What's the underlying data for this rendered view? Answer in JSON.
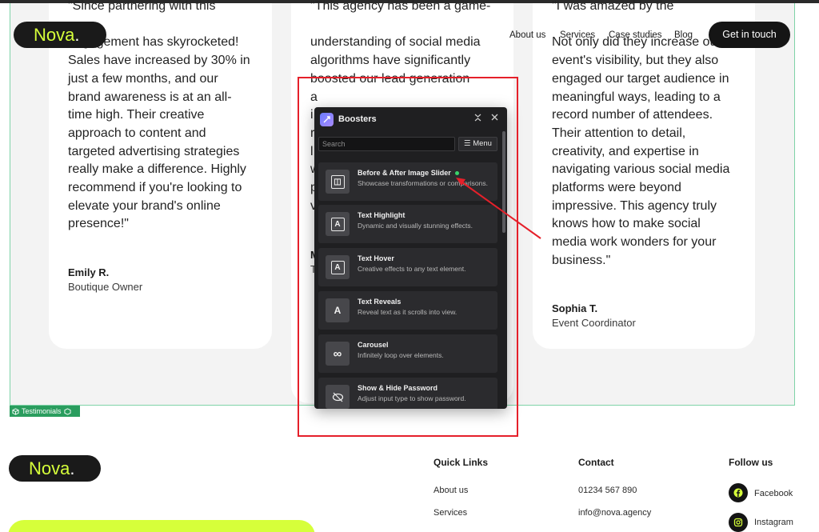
{
  "nav": {
    "logo_text": "Nova",
    "logo_dot": ".",
    "links": [
      "About us",
      "Services",
      "Case studies",
      "Blog"
    ],
    "cta": "Get in touch"
  },
  "testimonials": [
    {
      "lines": [
        "\"Since partnering with this",
        "",
        "engagement has skyrocketed!",
        "Sales have increased by 30% in",
        "just a few months, and our",
        "brand awareness is at an all-",
        "time high. Their creative",
        "approach to content and",
        "targeted advertising strategies",
        "really make a difference. Highly",
        "recommend if you're looking to",
        "elevate your brand's online",
        "presence!\""
      ],
      "author": "Emily R.",
      "role": "Boutique Owner"
    },
    {
      "lines": [
        "\"This agency has been a game-",
        "",
        "understanding of social media",
        "algorithms have significantly",
        "boosted our lead generation",
        "a",
        "i",
        "r",
        "l",
        "w",
        "p",
        "v"
      ],
      "author": "M",
      "role": "T"
    },
    {
      "lines": [
        "\"I was amazed by the",
        "",
        "Not only did they increase our",
        "event's visibility, but they also",
        "engaged our target audience in",
        "meaningful ways, leading to a",
        "record number of attendees.",
        "Their attention to detail,",
        "creativity, and expertise in",
        "navigating various social media",
        "platforms were beyond",
        "impressive. This agency truly",
        "knows how to make social",
        "media work wonders for your",
        "business.\""
      ],
      "author": "Sophia T.",
      "role": "Event Coordinator"
    }
  ],
  "section_tag": "Testimonials",
  "boosters": {
    "title": "Boosters",
    "search_placeholder": "Search",
    "menu_label": "Menu",
    "items": [
      {
        "title": "Before & After Image Slider",
        "desc": "Showcase transformations or comparisons.",
        "icon": "image-slider-icon"
      },
      {
        "title": "Text Highlight",
        "desc": "Dynamic and visually stunning effects.",
        "icon": "text-icon"
      },
      {
        "title": "Text Hover",
        "desc": "Creative effects to any text element.",
        "icon": "text-icon"
      },
      {
        "title": "Text Reveals",
        "desc": "Reveal text as it scrolls into view.",
        "icon": "text-reveal-icon"
      },
      {
        "title": "Carousel",
        "desc": "Infinitely loop over elements.",
        "icon": "infinity-icon"
      },
      {
        "title": "Show & Hide Password",
        "desc": "Adjust input type to show password.",
        "icon": "eye-off-icon"
      }
    ]
  },
  "footer": {
    "logo_text": "Nova",
    "logo_dot": ".",
    "quick_links_title": "Quick Links",
    "quick_links": [
      "About us",
      "Services"
    ],
    "contact_title": "Contact",
    "contact": [
      "01234 567 890",
      "info@nova.agency"
    ],
    "follow_title": "Follow us",
    "social": [
      "Facebook",
      "Instagram"
    ]
  },
  "colors": {
    "accent_lime": "#d6ff3a",
    "dark": "#1a1a1a",
    "section_border": "#7fd3a8",
    "tag_green": "#2a9d5e",
    "panel_bg": "#1f1f21",
    "annotation_red": "#e5202a"
  }
}
